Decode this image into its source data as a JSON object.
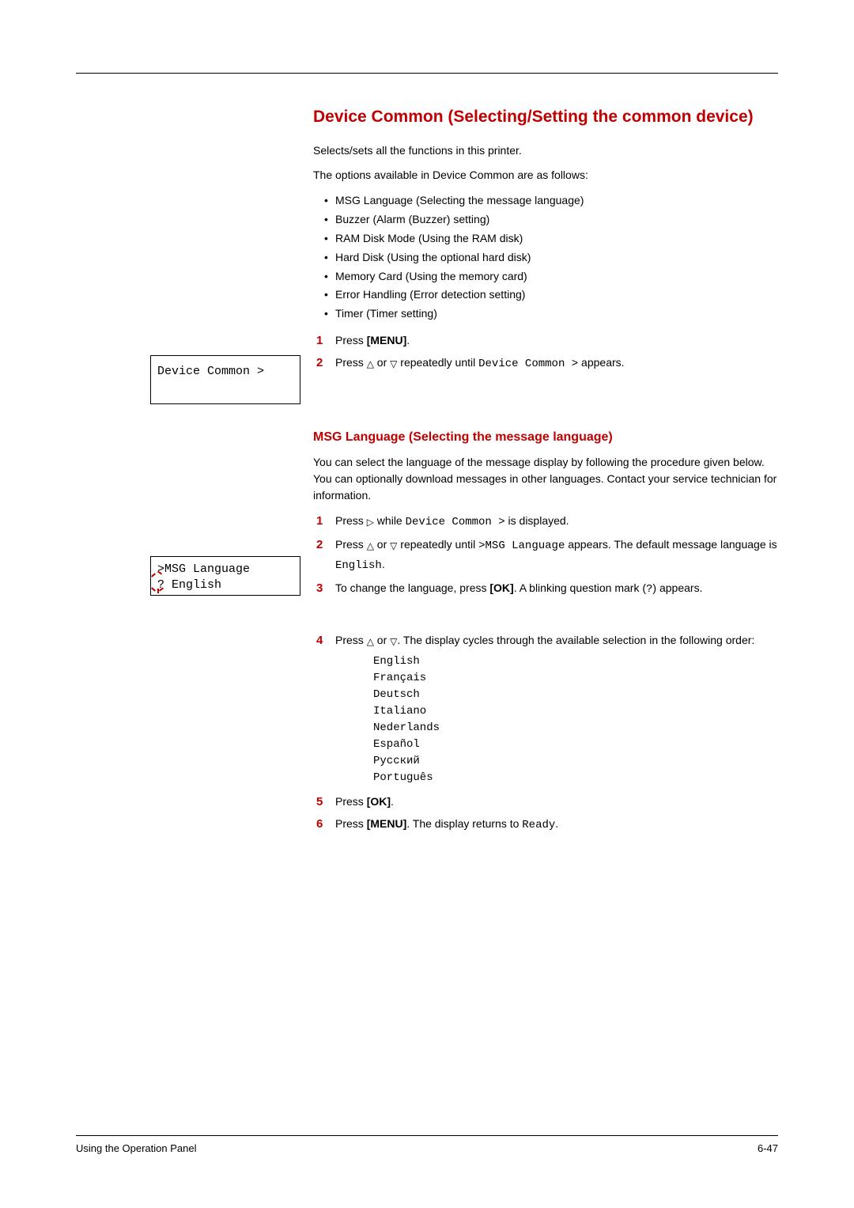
{
  "heading": "Device Common (Selecting/Setting the common device)",
  "intro1": "Selects/sets all the functions in this printer.",
  "intro2": "The options available in Device Common are as follows:",
  "options": [
    "MSG Language (Selecting the message language)",
    "Buzzer (Alarm (Buzzer) setting)",
    "RAM Disk Mode (Using the RAM disk)",
    "Hard Disk (Using the optional hard disk)",
    "Memory Card (Using the memory card)",
    "Error Handling (Error detection setting)",
    "Timer (Timer setting)"
  ],
  "stepsA": {
    "s1_a": "Press ",
    "s1_b": "[MENU]",
    "s1_c": ".",
    "s2_a": "Press ",
    "s2_b": " or ",
    "s2_c": " repeatedly until ",
    "s2_mono": "Device Common >",
    "s2_d": " appears."
  },
  "lcd1_line1": "Device Common  >",
  "sub_heading": "MSG Language (Selecting the message language)",
  "sub_intro": "You can select the language of the message display by following the procedure given below. You can optionally download messages in other languages. Contact your service technician for information.",
  "stepsB": {
    "s1_a": "Press ",
    "s1_b": " while ",
    "s1_mono": "Device Common >",
    "s1_c": " is displayed.",
    "s2_a": "Press ",
    "s2_b": " or ",
    "s2_c": " repeatedly until ",
    "s2_mono1": ">MSG Language",
    "s2_d": " appears. The default message language is ",
    "s2_mono2": "English",
    "s2_e": ".",
    "s3_a": "To change the language, press ",
    "s3_b": "[OK]",
    "s3_c": ". A blinking question mark (",
    "s3_mono": "?",
    "s3_d": ") appears.",
    "s4_a": "Press ",
    "s4_b": " or ",
    "s4_c": ". The display cycles through the available selection in the following order:",
    "s5_a": "Press ",
    "s5_b": "[OK]",
    "s5_c": ".",
    "s6_a": "Press ",
    "s6_b": "[MENU]",
    "s6_c": ". The display returns to ",
    "s6_mono": "Ready",
    "s6_d": "."
  },
  "lcd2_line1": ">MSG Language",
  "lcd2_line2a": "?",
  "lcd2_line2b": " English",
  "languages": [
    "English",
    "Français",
    "Deutsch",
    "Italiano",
    "Nederlands",
    "Español",
    "Русский",
    "Português"
  ],
  "footer_left": "Using the Operation Panel",
  "footer_right": "6-47",
  "chart_data": null
}
